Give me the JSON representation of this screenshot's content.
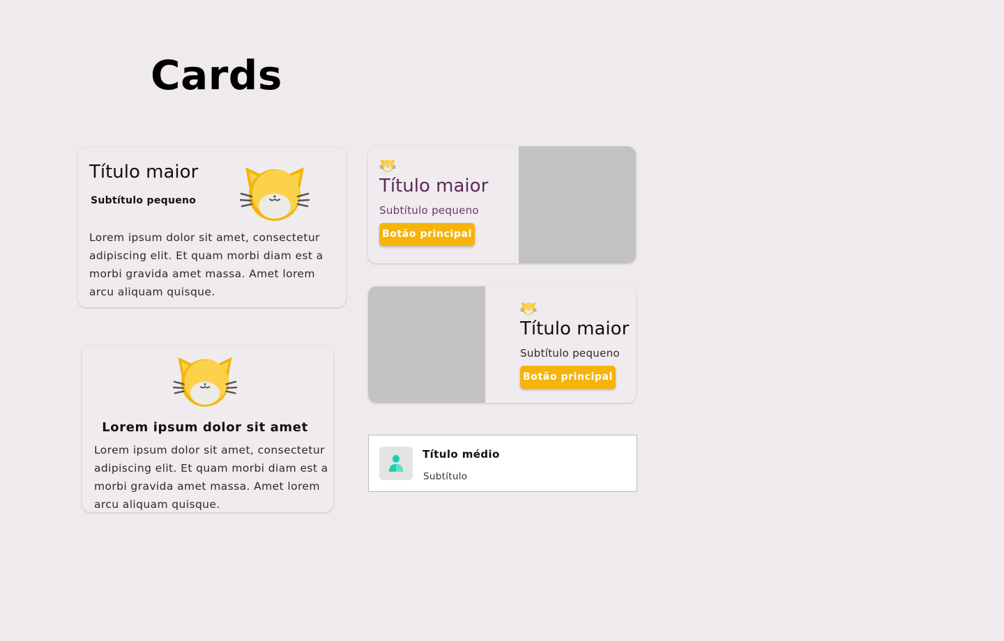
{
  "page": {
    "title": "Cards"
  },
  "colors": {
    "background": "#eeeaee",
    "card": "#efebef",
    "accent": "#f6b40b",
    "title_purple": "#5b2a55",
    "image_placeholder": "#c2c2c2",
    "avatar_icon": "#1ccfa9"
  },
  "card_feature": {
    "title": "Título maior",
    "subtitle": "Subtítulo pequeno",
    "icon": "cat-face-icon",
    "body": "Lorem ipsum dolor sit amet, consectetur adipiscing elit. Et quam morbi diam est a morbi gravida amet massa. Amet lorem arcu aliquam quisque."
  },
  "card_centered": {
    "icon": "cat-face-icon",
    "headline": "Lorem ipsum dolor sit amet",
    "body": "Lorem ipsum dolor sit amet, consectetur adipiscing elit. Et quam morbi diam est a morbi gravida amet massa. Amet lorem arcu aliquam quisque."
  },
  "card_media_right": {
    "icon": "cat-face-icon",
    "title": "Título maior",
    "subtitle": "Subtítulo pequeno",
    "button_label": "Botão principal"
  },
  "card_media_left": {
    "icon": "cat-face-icon",
    "title": "Título maior",
    "subtitle": "Subtítulo pequeno",
    "button_label": "Botão principal"
  },
  "card_list_item": {
    "icon": "user-icon",
    "title": "Título médio",
    "subtitle": "Subtítulo"
  }
}
